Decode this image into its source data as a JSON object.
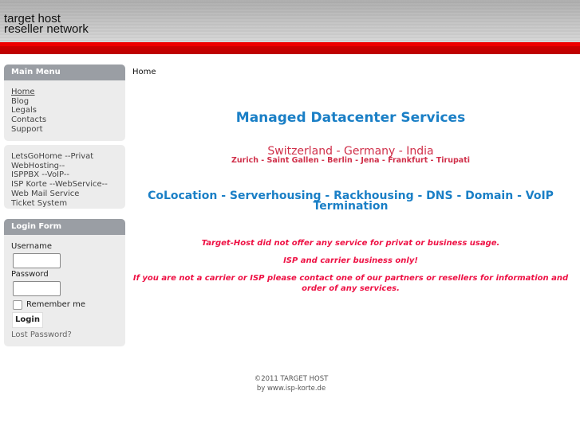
{
  "header": {
    "line1": "target host",
    "line2": "reseller network"
  },
  "main_menu": {
    "title": "Main Menu",
    "items": [
      "Home",
      "Blog",
      "Legals",
      "Contacts",
      "Support"
    ]
  },
  "links_menu": {
    "items": [
      "LetsGoHome --Privat",
      "WebHosting--",
      "ISPPBX --VoIP--",
      "ISP Korte --WebService--",
      "Web Mail Service",
      "Ticket System"
    ]
  },
  "login": {
    "title": "Login Form",
    "username_label": "Username",
    "username_value": "",
    "password_label": "Password",
    "password_value": "",
    "remember_label": "Remember me",
    "remember_checked": false,
    "login_button": "Login",
    "lost_password": "Lost Password?"
  },
  "breadcrumb": "Home",
  "content": {
    "title": "Managed Datacenter Services",
    "countries": "Switzerland - Germany - India",
    "cities": "Zurich - Saint Gallen - Berlin - Jena - Frankfurt - Tirupati",
    "services": "CoLocation - Serverhousing - Rackhousing - DNS - Domain - VoIP Termination",
    "notice1": "Target-Host did not offer any service for privat or business usage.",
    "notice2": "ISP and carrier business only!",
    "notice3": "If you are not a carrier or ISP please contact one of our partners or resellers for information and order of any services."
  },
  "footer": {
    "copyright": "©2011  TARGET HOST",
    "by": "by www.isp-korte.de"
  }
}
